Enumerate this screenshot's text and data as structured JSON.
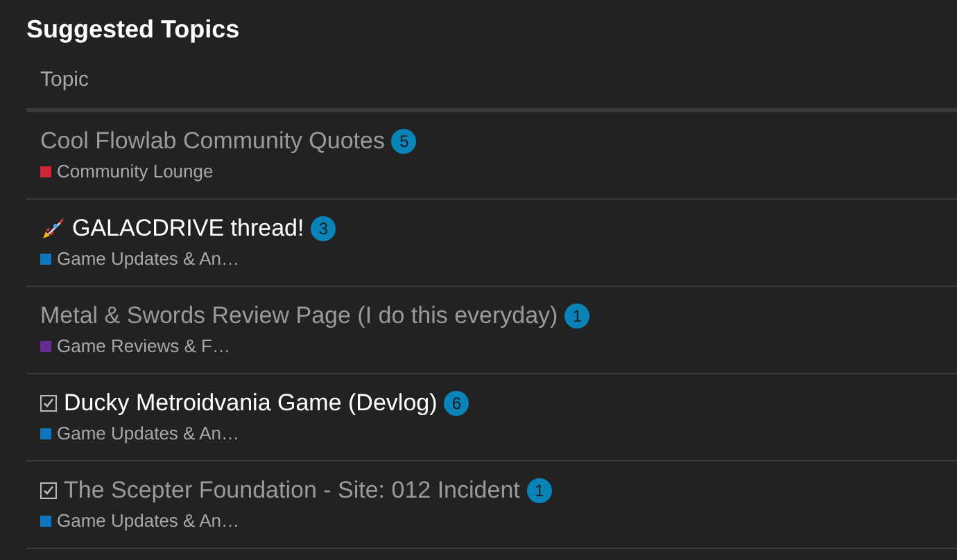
{
  "heading": "Suggested Topics",
  "columns": [
    "Topic"
  ],
  "topics": [
    {
      "title": "Cool Flowlab Community Quotes",
      "kind": "plain",
      "visited": true,
      "replies": "5",
      "category": {
        "name": "Community Lounge",
        "color": "#d0263a"
      }
    },
    {
      "title": "GALACDRIVE thread!",
      "kind": "rocket",
      "visited": false,
      "replies": "3",
      "category": {
        "name": "Game Updates & An…",
        "color": "#0e76bd"
      }
    },
    {
      "title": "Metal & Swords Review Page (I do this everyday)",
      "kind": "plain",
      "visited": true,
      "replies": "1",
      "category": {
        "name": "Game Reviews & F…",
        "color": "#652d90"
      }
    },
    {
      "title": "Ducky Metroidvania Game (Devlog)",
      "kind": "checked",
      "visited": false,
      "replies": "6",
      "category": {
        "name": "Game Updates & An…",
        "color": "#0e76bd"
      }
    },
    {
      "title": "The Scepter Foundation - Site: 012 Incident",
      "kind": "checked",
      "visited": true,
      "replies": "1",
      "category": {
        "name": "Game Updates & An…",
        "color": "#0e76bd"
      }
    }
  ]
}
